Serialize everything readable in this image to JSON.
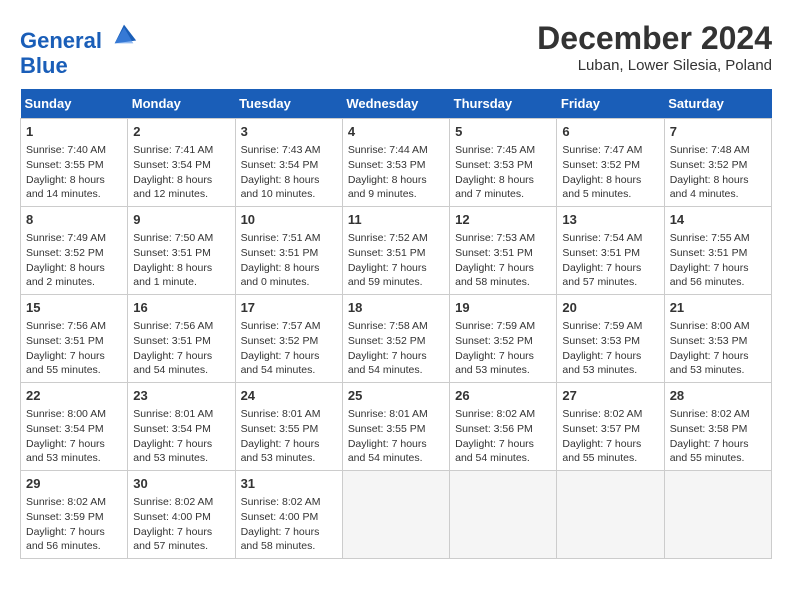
{
  "header": {
    "logo_line1": "General",
    "logo_line2": "Blue",
    "month": "December 2024",
    "location": "Luban, Lower Silesia, Poland"
  },
  "days_of_week": [
    "Sunday",
    "Monday",
    "Tuesday",
    "Wednesday",
    "Thursday",
    "Friday",
    "Saturday"
  ],
  "weeks": [
    [
      {
        "day": "1",
        "sunrise": "7:40 AM",
        "sunset": "3:55 PM",
        "daylight": "8 hours and 14 minutes."
      },
      {
        "day": "2",
        "sunrise": "7:41 AM",
        "sunset": "3:54 PM",
        "daylight": "8 hours and 12 minutes."
      },
      {
        "day": "3",
        "sunrise": "7:43 AM",
        "sunset": "3:54 PM",
        "daylight": "8 hours and 10 minutes."
      },
      {
        "day": "4",
        "sunrise": "7:44 AM",
        "sunset": "3:53 PM",
        "daylight": "8 hours and 9 minutes."
      },
      {
        "day": "5",
        "sunrise": "7:45 AM",
        "sunset": "3:53 PM",
        "daylight": "8 hours and 7 minutes."
      },
      {
        "day": "6",
        "sunrise": "7:47 AM",
        "sunset": "3:52 PM",
        "daylight": "8 hours and 5 minutes."
      },
      {
        "day": "7",
        "sunrise": "7:48 AM",
        "sunset": "3:52 PM",
        "daylight": "8 hours and 4 minutes."
      }
    ],
    [
      {
        "day": "8",
        "sunrise": "7:49 AM",
        "sunset": "3:52 PM",
        "daylight": "8 hours and 2 minutes."
      },
      {
        "day": "9",
        "sunrise": "7:50 AM",
        "sunset": "3:51 PM",
        "daylight": "8 hours and 1 minute."
      },
      {
        "day": "10",
        "sunrise": "7:51 AM",
        "sunset": "3:51 PM",
        "daylight": "8 hours and 0 minutes."
      },
      {
        "day": "11",
        "sunrise": "7:52 AM",
        "sunset": "3:51 PM",
        "daylight": "7 hours and 59 minutes."
      },
      {
        "day": "12",
        "sunrise": "7:53 AM",
        "sunset": "3:51 PM",
        "daylight": "7 hours and 58 minutes."
      },
      {
        "day": "13",
        "sunrise": "7:54 AM",
        "sunset": "3:51 PM",
        "daylight": "7 hours and 57 minutes."
      },
      {
        "day": "14",
        "sunrise": "7:55 AM",
        "sunset": "3:51 PM",
        "daylight": "7 hours and 56 minutes."
      }
    ],
    [
      {
        "day": "15",
        "sunrise": "7:56 AM",
        "sunset": "3:51 PM",
        "daylight": "7 hours and 55 minutes."
      },
      {
        "day": "16",
        "sunrise": "7:56 AM",
        "sunset": "3:51 PM",
        "daylight": "7 hours and 54 minutes."
      },
      {
        "day": "17",
        "sunrise": "7:57 AM",
        "sunset": "3:52 PM",
        "daylight": "7 hours and 54 minutes."
      },
      {
        "day": "18",
        "sunrise": "7:58 AM",
        "sunset": "3:52 PM",
        "daylight": "7 hours and 54 minutes."
      },
      {
        "day": "19",
        "sunrise": "7:59 AM",
        "sunset": "3:52 PM",
        "daylight": "7 hours and 53 minutes."
      },
      {
        "day": "20",
        "sunrise": "7:59 AM",
        "sunset": "3:53 PM",
        "daylight": "7 hours and 53 minutes."
      },
      {
        "day": "21",
        "sunrise": "8:00 AM",
        "sunset": "3:53 PM",
        "daylight": "7 hours and 53 minutes."
      }
    ],
    [
      {
        "day": "22",
        "sunrise": "8:00 AM",
        "sunset": "3:54 PM",
        "daylight": "7 hours and 53 minutes."
      },
      {
        "day": "23",
        "sunrise": "8:01 AM",
        "sunset": "3:54 PM",
        "daylight": "7 hours and 53 minutes."
      },
      {
        "day": "24",
        "sunrise": "8:01 AM",
        "sunset": "3:55 PM",
        "daylight": "7 hours and 53 minutes."
      },
      {
        "day": "25",
        "sunrise": "8:01 AM",
        "sunset": "3:55 PM",
        "daylight": "7 hours and 54 minutes."
      },
      {
        "day": "26",
        "sunrise": "8:02 AM",
        "sunset": "3:56 PM",
        "daylight": "7 hours and 54 minutes."
      },
      {
        "day": "27",
        "sunrise": "8:02 AM",
        "sunset": "3:57 PM",
        "daylight": "7 hours and 55 minutes."
      },
      {
        "day": "28",
        "sunrise": "8:02 AM",
        "sunset": "3:58 PM",
        "daylight": "7 hours and 55 minutes."
      }
    ],
    [
      {
        "day": "29",
        "sunrise": "8:02 AM",
        "sunset": "3:59 PM",
        "daylight": "7 hours and 56 minutes."
      },
      {
        "day": "30",
        "sunrise": "8:02 AM",
        "sunset": "4:00 PM",
        "daylight": "7 hours and 57 minutes."
      },
      {
        "day": "31",
        "sunrise": "8:02 AM",
        "sunset": "4:00 PM",
        "daylight": "7 hours and 58 minutes."
      },
      null,
      null,
      null,
      null
    ]
  ]
}
